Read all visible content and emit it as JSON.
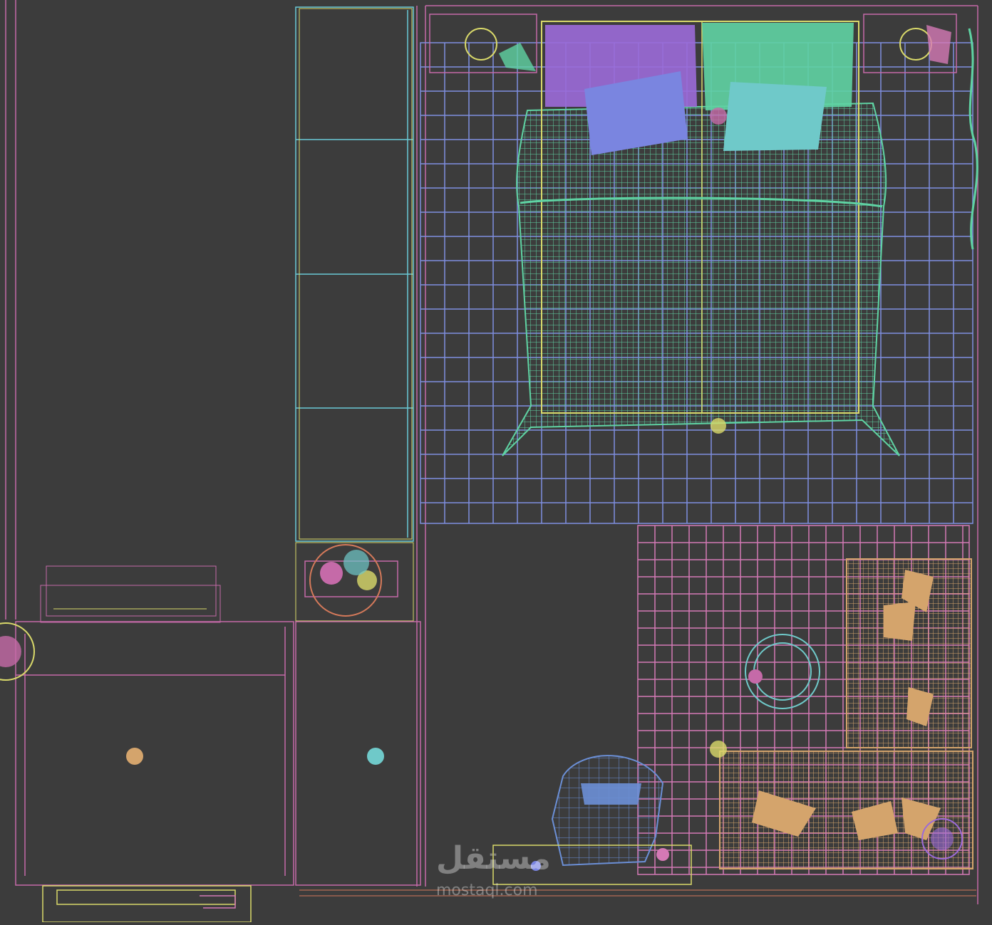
{
  "viewport": {
    "name": "top-view-wireframe",
    "background": "#3c3c3c"
  },
  "watermark": {
    "arabic": "مستقل",
    "latin": "mostaql.com"
  },
  "colors": {
    "bed": "#5fd3a3",
    "pillow_purple": "#9b6ad8",
    "pillow_blue": "#7a85e0",
    "pillow_teal": "#6fc9c9",
    "rug_grid_blue": "#7e8ee0",
    "rug_grid_pink": "#d479b5",
    "sofa": "#d4a46c",
    "chair": "#6b8fd6",
    "wall_pink": "#c56aa8",
    "cabinet_cyan": "#6ac9d6",
    "outline_yellow": "#d9d96a"
  },
  "objects": [
    "bed",
    "pillows",
    "rug",
    "sectional-sofa",
    "armchair",
    "round-coffee-table",
    "plants",
    "wardrobe",
    "desk",
    "nightstands"
  ]
}
